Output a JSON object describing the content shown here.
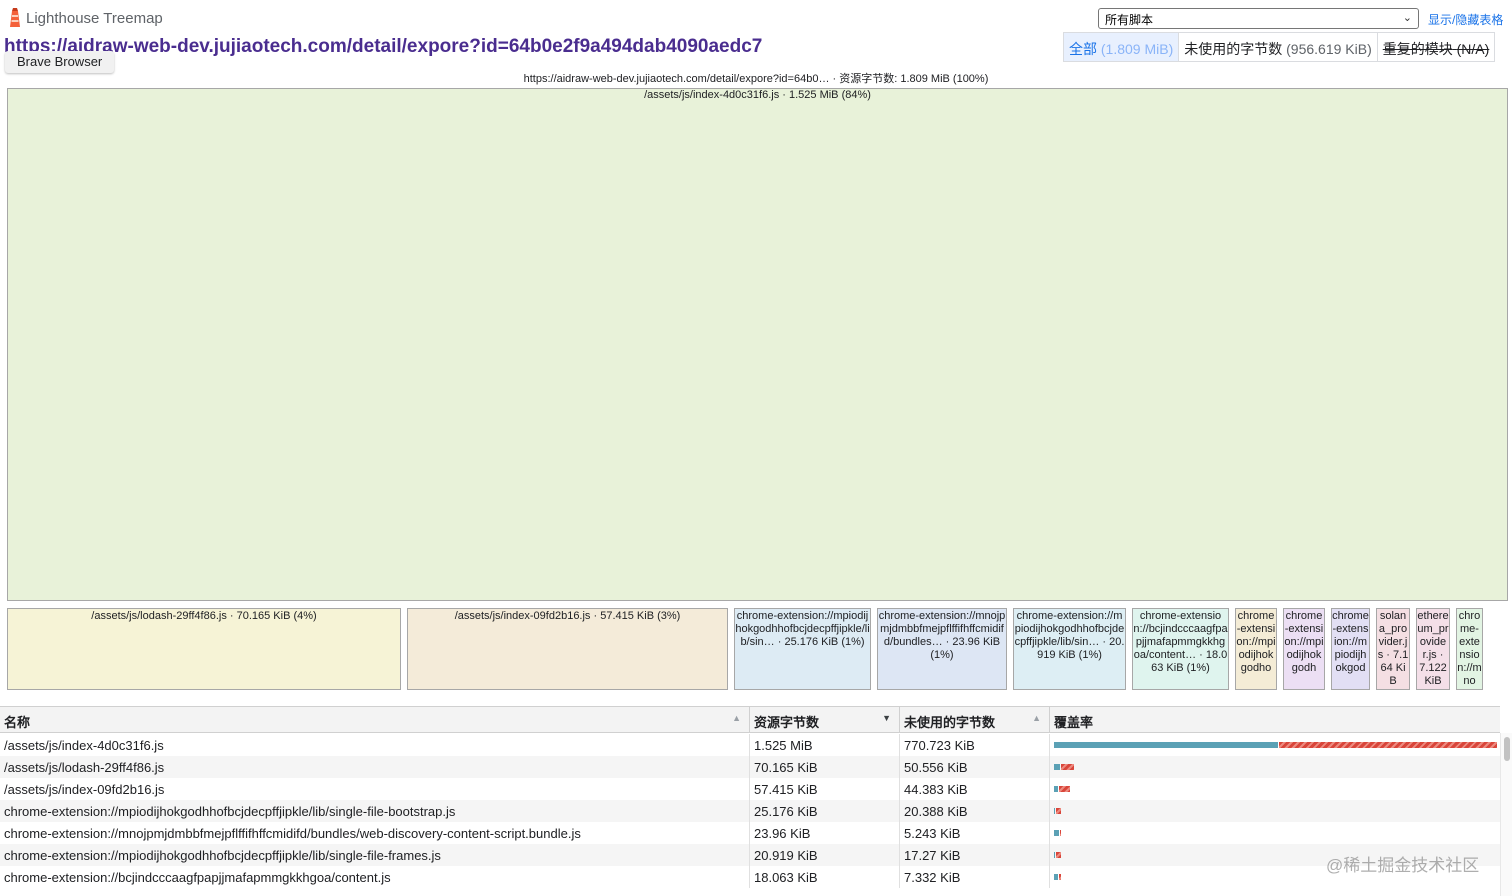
{
  "app": {
    "title": "Lighthouse Treemap"
  },
  "scope_select": {
    "value": "所有脚本"
  },
  "toggle_table_label": "显示/隐藏表格",
  "page_url": "https://aidraw-web-dev.jujiaotech.com/detail/expore?id=64b0e2f9a494dab4090aedc7",
  "tooltip": "Brave Browser",
  "tabs": [
    {
      "label": "全部",
      "sub": "(1.809 MiB)",
      "state": "active"
    },
    {
      "label": "未使用的字节数",
      "sub": "(956.619 KiB)",
      "state": "normal"
    },
    {
      "label": "重复的模块",
      "sub": "(N/A)",
      "state": "disabled"
    }
  ],
  "treemap": {
    "header": "https://aidraw-web-dev.jujiaotech.com/detail/expore?id=64b0… · 资源字节数: 1.809 MiB (100%)",
    "nodes": [
      {
        "label": "/assets/js/index-4d0c31f6.js · 1.525 MiB (84%)",
        "color": "#e8f2d9"
      },
      {
        "label": "/assets/js/lodash-29ff4f86.js · 70.165 KiB (4%)",
        "color": "#f6f3d6"
      },
      {
        "label": "/assets/js/index-09fd2b16.js · 57.415 KiB (3%)",
        "color": "#f4ebd9"
      },
      {
        "label": "chrome-extension://mpiodijhokgodhhofbcjdecpffjipkle/lib/sin… · 25.176 KiB (1%)",
        "color": "#ddebf4"
      },
      {
        "label": "chrome-extension://mnojpmjdmbbfmejpflffifhffcmidifd/bundles… · 23.96 KiB (1%)",
        "color": "#dde6f4"
      },
      {
        "label": "chrome-extension://mpiodijhokgodhhofbcjdecpffjipkle/lib/sin… · 20.919 KiB (1%)",
        "color": "#ddeef4"
      },
      {
        "label": "chrome-extension://bcjindcccaagfpapjjmafapmmgkkhgoa/content… · 18.063 KiB (1%)",
        "color": "#dff4ee"
      },
      {
        "label": "chrome-extension://mpiodijhokgodho",
        "color": "#f4ecd6"
      },
      {
        "label": "chrome-extension://mpiodijhokgodh",
        "color": "#ecdff4"
      },
      {
        "label": "chrome-extension://mpiodijhokgod",
        "color": "#e2dff4"
      },
      {
        "label": "solana_provider.js · 7.164 KiB",
        "color": "#f4dfe3"
      },
      {
        "label": "ethereum_provider.js · 7.122 KiB",
        "color": "#f4dfe8"
      },
      {
        "label": "chrome-extension://mno",
        "color": "#e2f4e3"
      }
    ]
  },
  "table": {
    "columns": [
      "名称",
      "资源字节数",
      "未使用的字节数",
      "覆盖率"
    ],
    "rows": [
      {
        "name": "/assets/js/index-4d0c31f6.js",
        "size": "1.525 MiB",
        "unused": "770.723 KiB",
        "coverage": {
          "total": 1.0,
          "used_fraction": 0.506
        }
      },
      {
        "name": "/assets/js/lodash-29ff4f86.js",
        "size": "70.165 KiB",
        "unused": "50.556 KiB",
        "coverage": {
          "total": 0.045,
          "used_fraction": 0.279
        }
      },
      {
        "name": "/assets/js/index-09fd2b16.js",
        "size": "57.415 KiB",
        "unused": "44.383 KiB",
        "coverage": {
          "total": 0.037,
          "used_fraction": 0.227
        }
      },
      {
        "name": "chrome-extension://mpiodijhokgodhhofbcjdecpffjipkle/lib/single-file-bootstrap.js",
        "size": "25.176 KiB",
        "unused": "20.388 KiB",
        "coverage": {
          "total": 0.016,
          "used_fraction": 0.19
        }
      },
      {
        "name": "chrome-extension://mnojpmjdmbbfmejpflffifhffcmidifd/bundles/web-discovery-content-script.bundle.js",
        "size": "23.96 KiB",
        "unused": "5.243 KiB",
        "coverage": {
          "total": 0.015,
          "used_fraction": 0.781
        }
      },
      {
        "name": "chrome-extension://mpiodijhokgodhhofbcjdecpffjipkle/lib/single-file-frames.js",
        "size": "20.919 KiB",
        "unused": "17.27 KiB",
        "coverage": {
          "total": 0.013,
          "used_fraction": 0.174
        }
      },
      {
        "name": "chrome-extension://bcjindcccaagfpapjjmafapmmgkkhgoa/content.js",
        "size": "18.063 KiB",
        "unused": "7.332 KiB",
        "coverage": {
          "total": 0.012,
          "used_fraction": 0.594
        }
      }
    ]
  },
  "watermark": "@稀土掘金技术社区",
  "colors": {
    "used": "#5ba1b5",
    "unused": "#d9453a",
    "accent": "#1a73e8",
    "url": "#4a2d8f"
  }
}
